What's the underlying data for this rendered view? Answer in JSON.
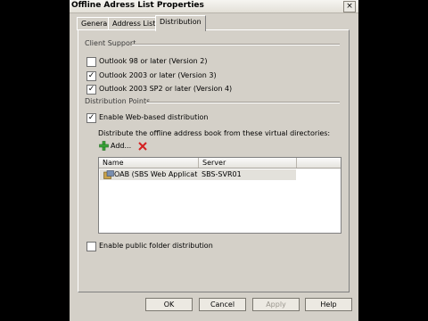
{
  "window": {
    "title": "Offline Adress List Properties",
    "close_label": "×"
  },
  "tabs": [
    {
      "label": "General"
    },
    {
      "label": "Address Lists"
    },
    {
      "label": "Distribution"
    }
  ],
  "client_support": {
    "label": "Client Support",
    "items": [
      {
        "label": "Outlook 98 or later (Version 2)",
        "checked": false
      },
      {
        "label": "Outlook 2003 or later (Version 3)",
        "checked": true
      },
      {
        "label": "Outlook 2003 SP2 or later (Version 4)",
        "checked": true
      }
    ]
  },
  "distribution_points": {
    "label": "Distribution Points",
    "web_based": {
      "label": "Enable Web-based distribution",
      "checked": true
    },
    "instruction": "Distribute the offline address book from these virtual directories:",
    "add_label": "Add...",
    "table": {
      "columns": [
        "Name",
        "Server"
      ],
      "rows": [
        {
          "name": "OAB (SBS Web Applicat...",
          "server": "SBS-SVR01"
        }
      ]
    },
    "public_folder": {
      "label": "Enable public folder distribution",
      "checked": false
    }
  },
  "buttons": {
    "ok": "OK",
    "cancel": "Cancel",
    "apply": "Apply",
    "help": "Help"
  },
  "icons": {
    "add": "green-plus-icon",
    "delete": "red-x-icon",
    "virtual_directory": "virtual-directory-icon"
  },
  "colors": {
    "plus_green": "#3aa53a",
    "delete_red": "#d42020"
  }
}
